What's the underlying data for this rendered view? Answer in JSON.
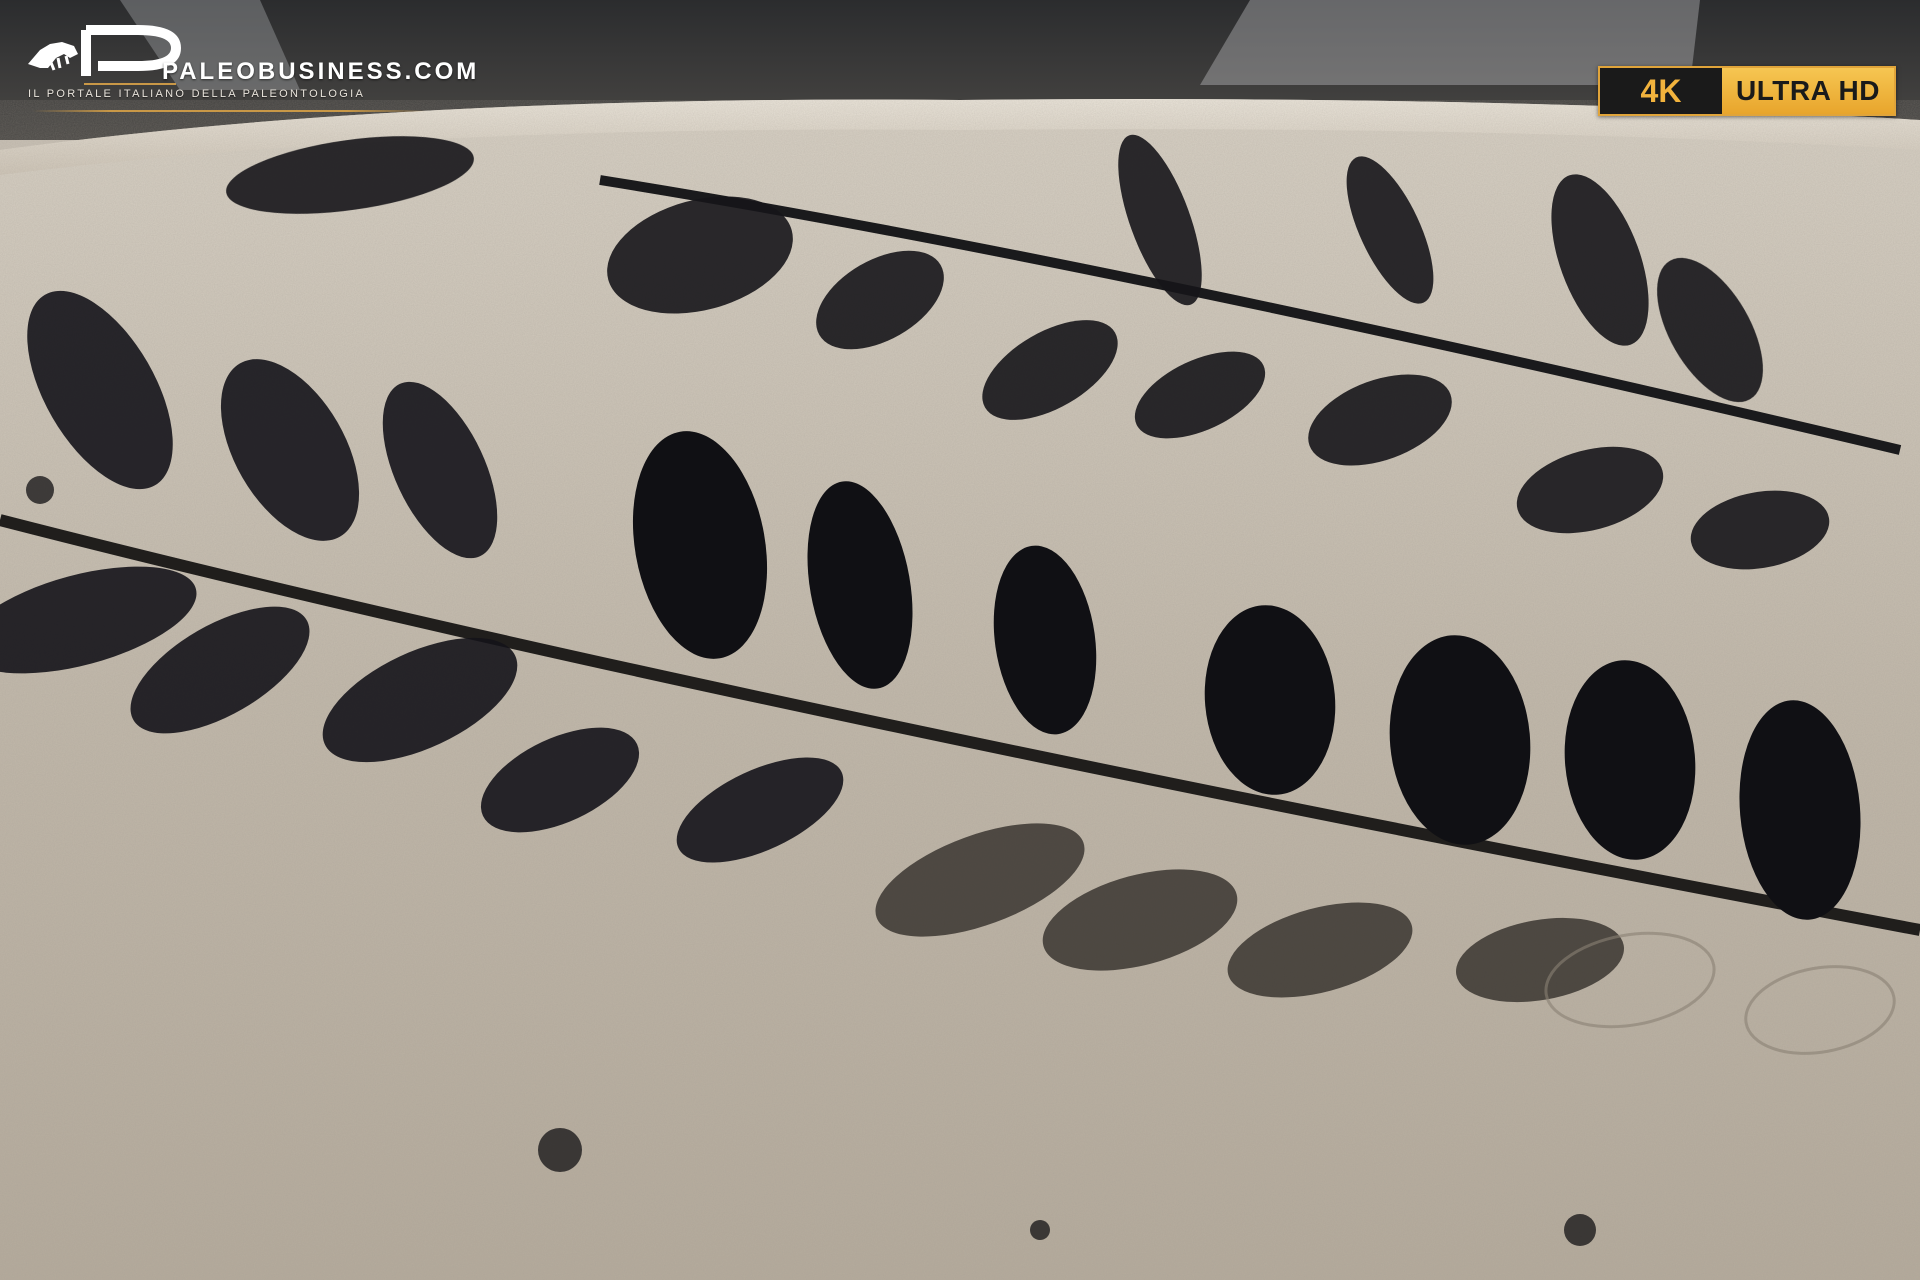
{
  "logo": {
    "brand": "PALEOBUSINESS.COM",
    "tagline": "IL PORTALE ITALIANO DELLA PALEONTOLOGIA",
    "rule_color": "#c99847"
  },
  "badge": {
    "resolution": "4K",
    "label": "ULTRA HD",
    "accent": "#f2b33d"
  },
  "photo": {
    "subject": "fossil-fern-frond-on-shale"
  }
}
